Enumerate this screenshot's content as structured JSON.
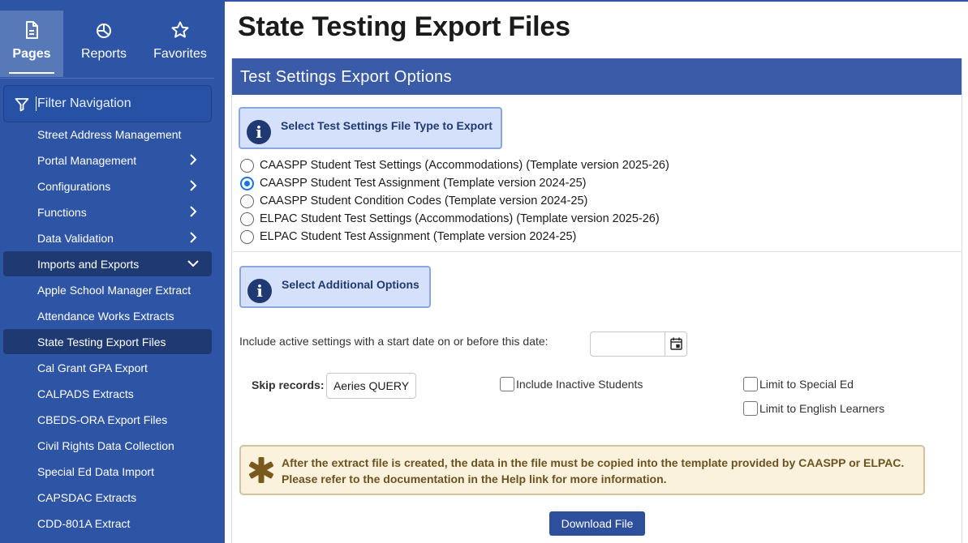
{
  "sidebar": {
    "tabs": [
      {
        "label": "Pages",
        "icon": "document-icon"
      },
      {
        "label": "Reports",
        "icon": "pie-chart-icon"
      },
      {
        "label": "Favorites",
        "icon": "star-icon"
      }
    ],
    "filter_placeholder": "Filter Navigation",
    "items": [
      {
        "label": "Street Address Management"
      },
      {
        "label": "Portal Management",
        "chevron": "right"
      },
      {
        "label": "Configurations",
        "chevron": "right"
      },
      {
        "label": "Functions",
        "chevron": "right"
      },
      {
        "label": "Data Validation",
        "chevron": "right"
      },
      {
        "label": "Imports and Exports",
        "chevron": "down"
      },
      {
        "label": "Apple School Manager Extract"
      },
      {
        "label": "Attendance Works Extracts"
      },
      {
        "label": "State Testing Export Files"
      },
      {
        "label": "Cal Grant GPA Export"
      },
      {
        "label": "CALPADS Extracts"
      },
      {
        "label": "CBEDS-ORA Export Files"
      },
      {
        "label": "Civil Rights Data Collection"
      },
      {
        "label": "Special Ed Data Import"
      },
      {
        "label": "CAPSDAC Extracts"
      },
      {
        "label": "CDD-801A Extract"
      }
    ]
  },
  "main": {
    "page_title": "State Testing Export Files",
    "section_title": "Test Settings Export Options",
    "file_type_info": "Select Test Settings File Type to Export",
    "file_types": [
      {
        "label": "CAASPP Student Test Settings (Accommodations) (Template version 2025-26)",
        "selected": false
      },
      {
        "label": "CAASPP Student Test Assignment (Template version 2024-25)",
        "selected": true
      },
      {
        "label": "CAASPP Student Condition Codes (Template version 2024-25)",
        "selected": false
      },
      {
        "label": "ELPAC Student Test Settings (Accommodations) (Template version 2025-26)",
        "selected": false
      },
      {
        "label": "ELPAC Student Test Assignment (Template version 2024-25)",
        "selected": false
      }
    ],
    "additional_info": "Select Additional Options",
    "date_label": "Include active settings with a start date on or before this date:",
    "date_value": "",
    "skip_label": "Skip records:",
    "skip_button": "Aeries QUERY",
    "checkboxes": {
      "include_inactive": "Include Inactive Students",
      "limit_special_ed": "Limit to Special Ed",
      "limit_english_learners": "Limit to English Learners"
    },
    "warning_line1": "After the extract file is created, the data in the file must be copied into the template provided by CAASPP or ELPAC.",
    "warning_line2": "Please refer to the documentation in the Help link for more information.",
    "download_label": "Download File"
  },
  "colors": {
    "sidebar_bg": "#2e55a5",
    "selected_item": "#1f3a73",
    "panel_header": "#3a5ba7",
    "info_bg": "#d5e1fb",
    "warning_bg": "#fbf2dd",
    "warning_icon": "#7a5a1c",
    "radio_accent": "#1a73e8"
  }
}
